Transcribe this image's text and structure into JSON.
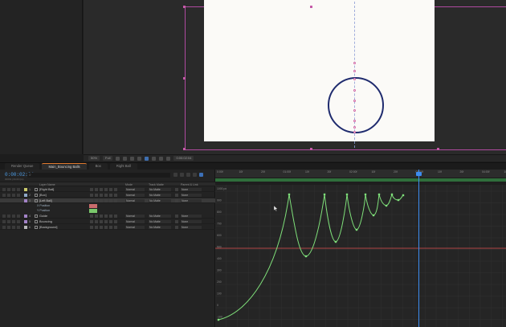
{
  "viewer": {
    "zoom": "50%",
    "resolution": "Full",
    "timecode": "0:00:02:04"
  },
  "tabs": [
    {
      "label": "Render Queue",
      "active": false
    },
    {
      "label": "Main_Bouncing Balls",
      "active": true
    },
    {
      "label": "Box",
      "active": false
    },
    {
      "label": "Right Ball",
      "active": false
    }
  ],
  "timeline": {
    "timecode": "0:00:02:04",
    "fps": "00064 (30.00 fps)",
    "search_placeholder": "",
    "columns": {
      "layer_name": "Layer Name",
      "mode": "Mode",
      "track_matte": "Track Matte",
      "parent": "Parent & Link"
    },
    "layers": [
      {
        "num": "1",
        "name": "[Right Ball]",
        "mode": "Normal",
        "matte": "No Matte",
        "parent": "None",
        "color": "#c9c96b",
        "selected": false
      },
      {
        "num": "2",
        "name": "[Box]",
        "mode": "Normal",
        "matte": "No Matte",
        "parent": "None",
        "color": "#8fa8c8",
        "selected": false
      },
      {
        "num": "3",
        "name": "[Left Ball]",
        "mode": "Normal",
        "matte": "No Matte",
        "parent": "None",
        "color": "#a383c7",
        "selected": true
      },
      {
        "num": "4",
        "name": "Guide",
        "mode": "Normal",
        "matte": "No Matte",
        "parent": "None",
        "color": "#a383c7",
        "selected": false
      },
      {
        "num": "5",
        "name": "Bouncing",
        "mode": "Normal",
        "matte": "No Matte",
        "parent": "None",
        "color": "#a383c7",
        "selected": false
      },
      {
        "num": "6",
        "name": "[Background]",
        "mode": "Normal",
        "matte": "No Matte",
        "parent": "None",
        "color": "#b8b8b8",
        "selected": false
      }
    ],
    "properties": [
      {
        "name": "X Position",
        "swatch": "#c86b6b"
      },
      {
        "name": "Y Position",
        "swatch": "#7ac86b"
      }
    ]
  },
  "graph": {
    "time_labels": [
      "0:00f",
      "10f",
      "20f",
      "01:00f",
      "10f",
      "20f",
      "02:00f",
      "10f",
      "20f",
      "03:00f",
      "10f",
      "20f",
      "04:00f",
      "10f"
    ],
    "y_labels": [
      "1000 px",
      "900",
      "800",
      "700",
      "600",
      "500",
      "400",
      "300",
      "200",
      "100",
      "0",
      "-100"
    ],
    "curve_color": "#7fe07a",
    "line_color": "#e05050",
    "cti_color": "#3c8cf0"
  }
}
